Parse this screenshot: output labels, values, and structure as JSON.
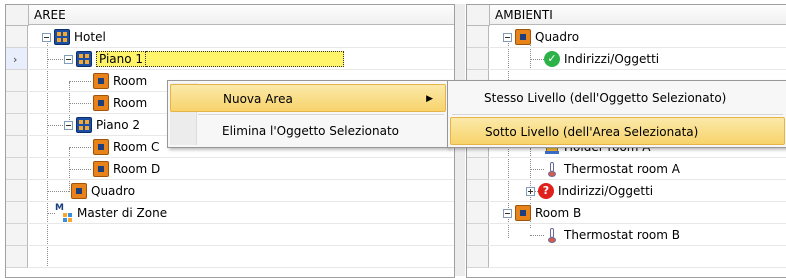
{
  "left": {
    "header": "AREE",
    "rows": [
      {
        "label": "Hotel",
        "icon": "area"
      },
      {
        "label": "Piano 1",
        "icon": "area"
      },
      {
        "label": "Room",
        "icon": "room"
      },
      {
        "label": "Room",
        "icon": "room"
      },
      {
        "label": "Piano 2",
        "icon": "area"
      },
      {
        "label": "Room C",
        "icon": "room"
      },
      {
        "label": "Room D",
        "icon": "room"
      },
      {
        "label": "Quadro",
        "icon": "room"
      },
      {
        "label": "Master di Zone",
        "icon": "master"
      }
    ],
    "current_row_arrow": "›"
  },
  "right": {
    "header": "AMBIENTI",
    "rows": [
      {
        "label": "Quadro",
        "icon": "room"
      },
      {
        "label": "Indirizzi/Oggetti",
        "icon": "check"
      },
      {
        "label": "Holder room A",
        "icon": "holder"
      },
      {
        "label": "Thermostat room A",
        "icon": "thermostat"
      },
      {
        "label": "Indirizzi/Oggetti",
        "icon": "question"
      },
      {
        "label": "Room B",
        "icon": "room"
      },
      {
        "label": "Thermostat room B",
        "icon": "thermostat"
      }
    ]
  },
  "context_menu": {
    "items": [
      {
        "label": "Nuova Area",
        "submenu_arrow": "▶"
      },
      {
        "label": "Elimina l'Oggetto Selezionato"
      }
    ],
    "submenu": [
      {
        "label": "Stesso Livello (dell'Oggetto Selezionato)"
      },
      {
        "label": "Sotto Livello (dell'Area Selezionata)"
      }
    ]
  },
  "colors": {
    "selection_highlight": "#fff46a",
    "menu_hover": "#f7d36b",
    "area_icon": "#1a4fa5",
    "room_icon": "#e8831c"
  }
}
